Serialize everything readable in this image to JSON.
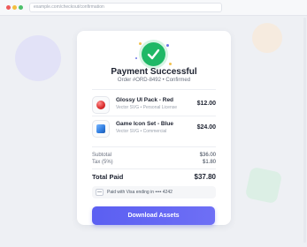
{
  "browser": {
    "url": "example.com/checkout/confirmation"
  },
  "confirmation": {
    "title": "Payment Successful",
    "subtitle": "Order #ORD-8492 • Confirmed"
  },
  "items": [
    {
      "name": "Glossy UI Pack - Red",
      "meta": "Vector SVG • Personal License",
      "price": "$12.00",
      "thumb_color": "#d92b2b"
    },
    {
      "name": "Game Icon Set - Blue",
      "meta": "Vector SVG • Commercial",
      "price": "$24.00",
      "thumb_color": "#2f7de0"
    }
  ],
  "summary": {
    "subtotal_label": "Subtotal",
    "subtotal_value": "$36.00",
    "tax_label": "Tax (5%)",
    "tax_value": "$1.80",
    "total_label": "Total Paid",
    "total_value": "$37.80"
  },
  "payment": {
    "text": "Paid with Visa ending in •••• 4242"
  },
  "actions": {
    "download_label": "Download Assets"
  },
  "colors": {
    "success": "#1fb866",
    "accent": "#5b5ff2"
  }
}
